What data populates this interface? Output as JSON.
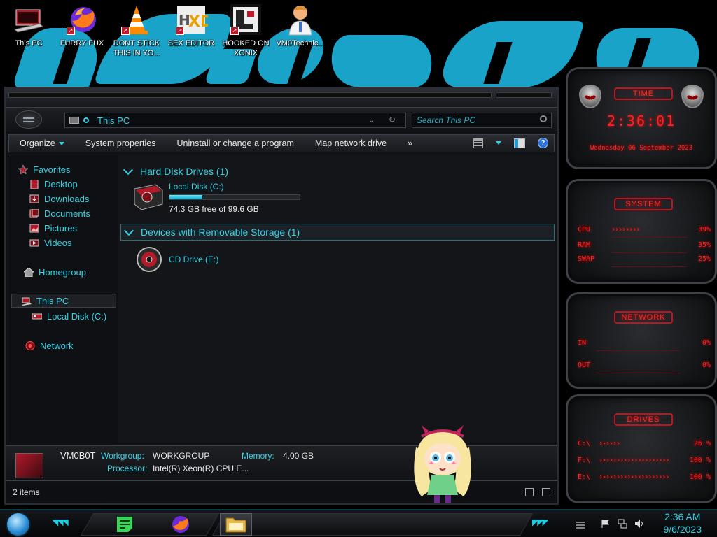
{
  "desktop": {
    "icons": [
      {
        "label": "This PC"
      },
      {
        "label": "FURRY FUX"
      },
      {
        "label": "DONT STICK THIS IN YO..."
      },
      {
        "label": "SEX EDITOR"
      },
      {
        "label": "HOOKED ON XONIX"
      },
      {
        "label": "VM0Technic..."
      }
    ]
  },
  "explorer": {
    "address": "This PC",
    "search_placeholder": "Search This PC",
    "commands": {
      "organize": "Organize",
      "system_properties": "System properties",
      "uninstall": "Uninstall or change a program",
      "map_drive": "Map network drive",
      "more": "»"
    },
    "sidebar": {
      "favorites": "Favorites",
      "desktop": "Desktop",
      "downloads": "Downloads",
      "documents": "Documents",
      "pictures": "Pictures",
      "videos": "Videos",
      "homegroup": "Homegroup",
      "this_pc": "This PC",
      "local_disk": "Local Disk (C:)",
      "network": "Network"
    },
    "groups": {
      "hdd": "Hard Disk Drives (1)",
      "removable": "Devices with Removable Storage (1)"
    },
    "drives": {
      "c_name": "Local Disk (C:)",
      "c_free": "74.3 GB free of 99.6 GB",
      "c_used_fraction": 0.254,
      "e_name": "CD Drive (E:)"
    },
    "details": {
      "computer_name": "VM0B0T",
      "workgroup_label": "Workgroup:",
      "workgroup_value": "WORKGROUP",
      "memory_label": "Memory:",
      "memory_value": "4.00 GB",
      "processor_label": "Processor:",
      "processor_value": "Intel(R) Xeon(R) CPU E..."
    },
    "status": "2 items"
  },
  "gadgets": {
    "time": {
      "title": "TIME",
      "clock": "2:36:01",
      "date": "Wednesday 06 September 2023"
    },
    "system": {
      "title": "SYSTEM",
      "rows": [
        {
          "label": "CPU",
          "arrows": "››››››››",
          "value": "39%"
        },
        {
          "label": "RAM",
          "arrows": "",
          "value": "35%"
        },
        {
          "label": "SWAP",
          "arrows": "",
          "value": "25%"
        }
      ]
    },
    "network": {
      "title": "NETWORK",
      "rows": [
        {
          "label": "IN",
          "value": "0%"
        },
        {
          "label": "OUT",
          "value": "0%"
        }
      ]
    },
    "drives": {
      "title": "DRIVES",
      "rows": [
        {
          "label": "C:\\",
          "arrows": "››››››",
          "value": "26 %"
        },
        {
          "label": "F:\\",
          "arrows": "››››››››››››››››››››",
          "value": "100 %"
        },
        {
          "label": "E:\\",
          "arrows": "››››››››››››››››››››",
          "value": "100 %"
        }
      ]
    }
  },
  "taskbar": {
    "time": "2:36 AM",
    "date": "9/6/2023"
  },
  "colors": {
    "accent": "#35d2e6",
    "gadget_red": "#ff2424",
    "window_bg": "#141518"
  }
}
